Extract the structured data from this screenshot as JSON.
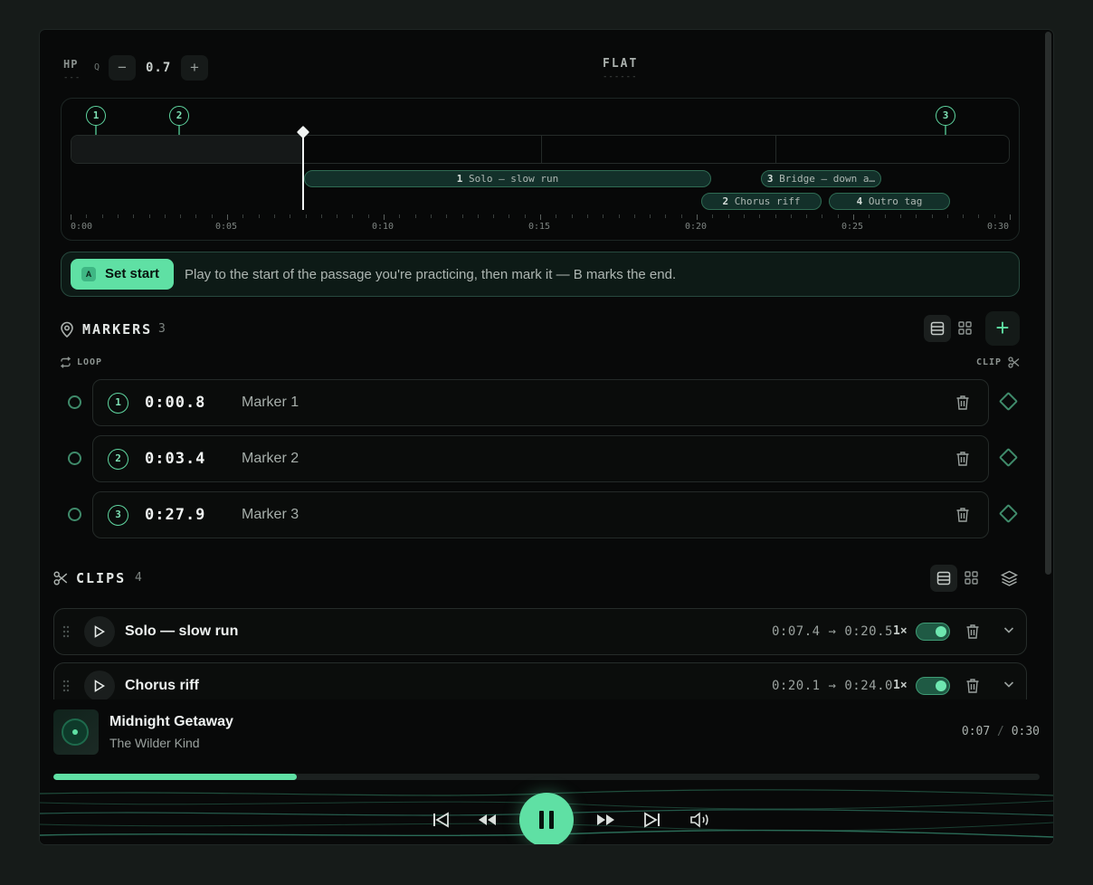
{
  "filter": {
    "type_label": "HP",
    "type_dash": "---",
    "q_label": "Q",
    "q_minus": "−",
    "q_value": "0.7",
    "q_plus": "+",
    "eq_label": "FLAT",
    "eq_dash": "------"
  },
  "timeline": {
    "pins": [
      "1",
      "2",
      "3"
    ],
    "clips": [
      {
        "num": "1",
        "label": "Solo — slow run"
      },
      {
        "num": "3",
        "label": "Bridge — down a…"
      },
      {
        "num": "2",
        "label": "Chorus riff"
      },
      {
        "num": "4",
        "label": "Outro tag"
      }
    ],
    "tick_labels": [
      "0:00",
      "0:05",
      "0:10",
      "0:15",
      "0:20",
      "0:25",
      "0:30"
    ],
    "playhead_fraction": 0.24
  },
  "banner": {
    "key": "A",
    "button_label": "Set start",
    "hint": "Play to the start of the passage you're practicing, then mark it — B marks the end."
  },
  "markers_section": {
    "title": "MARKERS",
    "count": "3",
    "loop_label": "LOOP",
    "clip_label": "CLIP",
    "add_label": "+",
    "items": [
      {
        "num": "1",
        "time": "0:00.8",
        "name": "Marker 1"
      },
      {
        "num": "2",
        "time": "0:03.4",
        "name": "Marker 2"
      },
      {
        "num": "3",
        "time": "0:27.9",
        "name": "Marker 3"
      }
    ]
  },
  "clips_section": {
    "title": "CLIPS",
    "count": "4",
    "items": [
      {
        "name": "Solo — slow run",
        "range": "0:07.4 → 0:20.5",
        "rate": "1×",
        "enabled": true
      },
      {
        "name": "Chorus riff",
        "range": "0:20.1 → 0:24.0",
        "rate": "1×",
        "enabled": true
      }
    ]
  },
  "now_playing": {
    "title": "Midnight Getaway",
    "artist": "The Wilder Kind",
    "elapsed": "0:07",
    "separator": "/",
    "duration": "0:30",
    "progress_fraction": 0.247
  },
  "colors": {
    "accent": "#5fe0a4",
    "background": "#080909",
    "page": "#161b19"
  },
  "icons": {
    "markers": "map-pin-icon",
    "loop": "loop-icon",
    "clip": "scissors-icon",
    "list_view": "list-view-icon",
    "grid_view": "grid-view-icon",
    "layers": "layers-icon",
    "delete": "trash-icon",
    "expand": "chevron-down-icon"
  }
}
